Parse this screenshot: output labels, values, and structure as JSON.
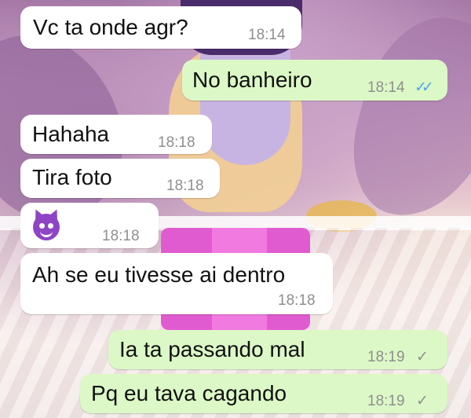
{
  "messages": [
    {
      "direction": "incoming",
      "text": "Vc ta onde agr?",
      "time": "18:14"
    },
    {
      "direction": "outgoing",
      "text": "No banheiro",
      "time": "18:14",
      "status": "read",
      "status_icon": "double-check-icon"
    },
    {
      "direction": "incoming",
      "text": "Hahaha",
      "time": "18:18"
    },
    {
      "direction": "incoming",
      "text": "Tira foto",
      "time": "18:18"
    },
    {
      "direction": "incoming",
      "emoji": "smiling-devil-emoji",
      "time": "18:18"
    },
    {
      "direction": "incoming",
      "text": "Ah se eu tivesse ai dentro",
      "time": "18:18"
    },
    {
      "direction": "outgoing",
      "text": "Ia ta passando mal",
      "time": "18:19",
      "status": "sent",
      "status_icon": "single-check-icon"
    },
    {
      "direction": "outgoing",
      "text": "Pq eu tava cagando",
      "time": "18:19",
      "status": "sent",
      "status_icon": "single-check-icon"
    }
  ],
  "colors": {
    "incoming_bubble": "#ffffff",
    "outgoing_bubble": "#dcf8c6",
    "read_tick": "#4fa6e8",
    "sent_tick": "#8f8f8f"
  }
}
